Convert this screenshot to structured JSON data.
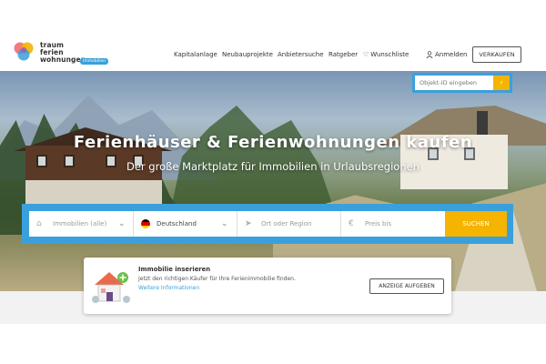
{
  "brand": {
    "line1": "traum",
    "line2": "ferien",
    "line3": "wohnungen",
    "badge": "Immobilien"
  },
  "nav": {
    "items": [
      "Kapitalanlage",
      "Neubauprojekte",
      "Anbietersuche",
      "Ratgeber",
      "Wunschliste"
    ],
    "login": "Anmelden",
    "sell": "VERKAUFEN"
  },
  "hero": {
    "title": "Ferienhäuser & Ferienwohnungen kaufen",
    "subtitle": "Der große Marktplatz für Immobilien in Urlaubsregionen"
  },
  "id_search": {
    "placeholder": "Objekt-ID eingeben",
    "go": "›"
  },
  "search": {
    "type_value": "Immobilien (alle)",
    "country_value": "Deutschland",
    "location_placeholder": "Ort oder Region",
    "price_placeholder": "Preis bis",
    "button": "SUCHEN"
  },
  "card": {
    "title": "Immobilie inserieren",
    "text": "Jetzt den richtigen Käufer für Ihre Ferienimmobilie finden.",
    "link": "Weitere Informationen",
    "button": "ANZEIGE AUFGEBEN"
  },
  "colors": {
    "accent_blue": "#3aa0dc",
    "accent_yellow": "#f4b400"
  }
}
